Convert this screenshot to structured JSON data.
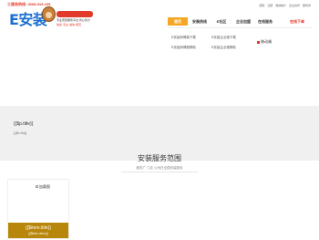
{
  "header": {
    "hotline": "三服务热线: 4008-915-105",
    "logo_text": "E安装",
    "logo_sub1": "专业安装服务平台 省心省力",
    "logo_sub2": "快捷·专业·诚信·规范",
    "top_links": [
      "服务",
      "注册",
      "我的帐户",
      "企业合作",
      "服务商"
    ],
    "nav": [
      {
        "label": "首页",
        "active": true
      },
      {
        "label": "安装热线",
        "active": false
      },
      {
        "label": "E社区",
        "active": false
      },
      {
        "label": "企业加盟",
        "active": false
      },
      {
        "label": "在线服务",
        "active": false
      }
    ],
    "nav_cta": "在线下单"
  },
  "dropdown": {
    "subtitle": "移动端",
    "links": [
      "E安装师傅端下载",
      "E安装企业端下载",
      "E安装师傅端帮助",
      "E安装企业端帮助"
    ]
  },
  "banner": {
    "title": "{{$p.title}}",
    "desc": "{{$v.fsi}}"
  },
  "section": {
    "title": "安装服务范围",
    "subtitle": "服务广 门店 公司在全国安装服务",
    "card": {
      "img_alt": "加载图",
      "title": "{{$item.title}}",
      "desc": "{{$item.desc}}"
    }
  },
  "colors": {
    "accent": "#f5a623",
    "brand_red": "#e23b2b",
    "brand_blue": "#1e6fd0",
    "card_gold": "#b8860b"
  }
}
